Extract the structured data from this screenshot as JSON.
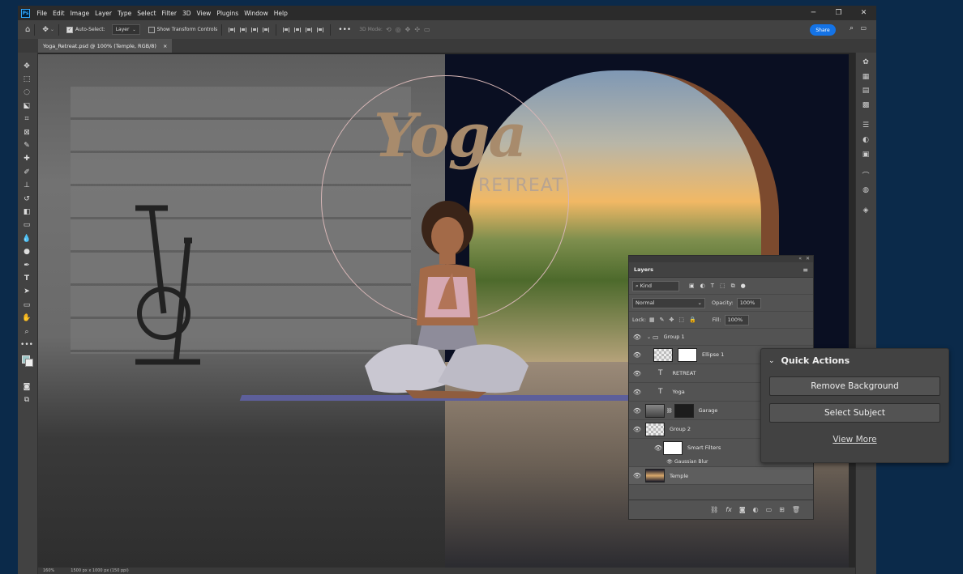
{
  "menu": [
    "File",
    "Edit",
    "Image",
    "Layer",
    "Type",
    "Select",
    "Filter",
    "3D",
    "View",
    "Plugins",
    "Window",
    "Help"
  ],
  "app_logo": "Ps",
  "options": {
    "auto_select_label": "Auto-Select:",
    "auto_select_value": "Layer",
    "transform_label": "Show Transform Controls",
    "mode_3d_label": "3D Mode:",
    "share_label": "Share"
  },
  "document": {
    "tab_title": "Yoga_Retreat.psd @ 100% (Temple, RGB/8)",
    "close_glyph": "×"
  },
  "artwork": {
    "title": "Yoga",
    "subtitle": "RETREAT"
  },
  "status": {
    "zoom": "160%",
    "doc_size": "1500 px x 1000 px (150 ppi)"
  },
  "layers_panel": {
    "tab": "Layers",
    "kind_label": "Kind",
    "blend_mode": "Normal",
    "opacity_label": "Opacity:",
    "opacity_value": "100%",
    "lock_label": "Lock:",
    "fill_label": "Fill:",
    "fill_value": "100%",
    "layers": [
      {
        "name": "Group 1",
        "type": "group"
      },
      {
        "name": "Ellipse 1",
        "type": "shape"
      },
      {
        "name": "RETREAT",
        "type": "text"
      },
      {
        "name": "Yoga",
        "type": "text"
      },
      {
        "name": "Garage",
        "type": "image"
      },
      {
        "name": "Group 2",
        "type": "group"
      },
      {
        "name": "Smart Filters",
        "type": "filter"
      },
      {
        "name": "Gaussian Blur",
        "type": "filter-item"
      },
      {
        "name": "Temple",
        "type": "image"
      }
    ]
  },
  "quick_actions": {
    "title": "Quick Actions",
    "buttons": [
      "Remove Background",
      "Select Subject"
    ],
    "view_more": "View More"
  },
  "colors": {
    "accent": "#1473e6",
    "panel": "#535353",
    "chrome": "#2b2b2b"
  }
}
